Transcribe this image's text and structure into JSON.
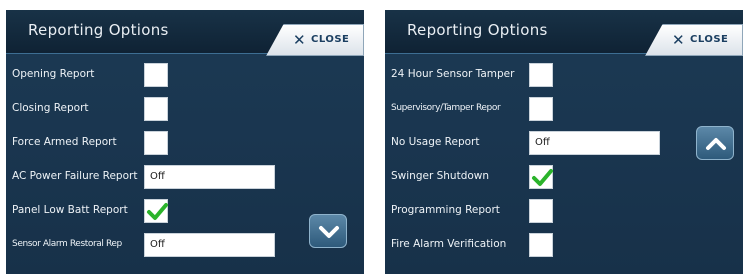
{
  "colors": {
    "panel_background": "#1a3650",
    "header_background": "#0f2234",
    "check_green": "#2bb32b",
    "close_text": "#1b3f61"
  },
  "left_panel": {
    "title": "Reporting Options",
    "close_label": "CLOSE",
    "close_icon": "x-icon",
    "scroll_icon": "chevron-down-icon",
    "rows": [
      {
        "label": "Opening Report",
        "control": "checkbox",
        "checked": false
      },
      {
        "label": "Closing Report",
        "control": "checkbox",
        "checked": false
      },
      {
        "label": "Force Armed Report",
        "control": "checkbox",
        "checked": false
      },
      {
        "label": "AC Power Failure Report",
        "control": "select",
        "value": "Off"
      },
      {
        "label": "Panel Low Batt Report",
        "control": "checkbox",
        "checked": true
      },
      {
        "label": "Sensor Alarm Restoral Rep",
        "control": "select",
        "value": "Off"
      }
    ]
  },
  "right_panel": {
    "title": "Reporting Options",
    "close_label": "CLOSE",
    "close_icon": "x-icon",
    "scroll_icon": "chevron-up-icon",
    "rows": [
      {
        "label": "24 Hour Sensor Tamper",
        "control": "checkbox",
        "checked": false
      },
      {
        "label": "Supervisory/Tamper Repor",
        "control": "checkbox",
        "checked": false
      },
      {
        "label": "No Usage Report",
        "control": "select",
        "value": "Off"
      },
      {
        "label": "Swinger Shutdown",
        "control": "checkbox",
        "checked": true
      },
      {
        "label": "Programming Report",
        "control": "checkbox",
        "checked": false
      },
      {
        "label": "Fire Alarm Verification",
        "control": "checkbox",
        "checked": false
      }
    ]
  }
}
